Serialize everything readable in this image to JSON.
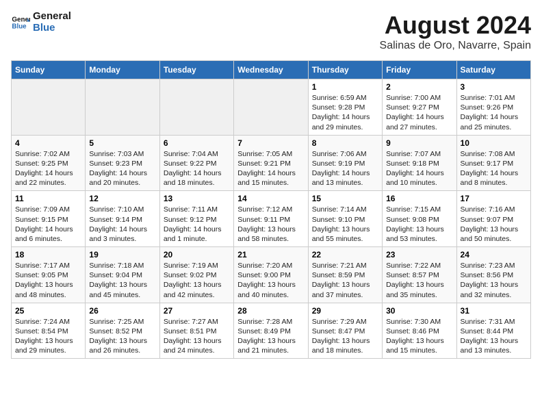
{
  "header": {
    "logo_line1": "General",
    "logo_line2": "Blue",
    "title": "August 2024",
    "subtitle": "Salinas de Oro, Navarre, Spain"
  },
  "weekdays": [
    "Sunday",
    "Monday",
    "Tuesday",
    "Wednesday",
    "Thursday",
    "Friday",
    "Saturday"
  ],
  "weeks": [
    [
      {
        "day": "",
        "info": ""
      },
      {
        "day": "",
        "info": ""
      },
      {
        "day": "",
        "info": ""
      },
      {
        "day": "",
        "info": ""
      },
      {
        "day": "1",
        "info": "Sunrise: 6:59 AM\nSunset: 9:28 PM\nDaylight: 14 hours\nand 29 minutes."
      },
      {
        "day": "2",
        "info": "Sunrise: 7:00 AM\nSunset: 9:27 PM\nDaylight: 14 hours\nand 27 minutes."
      },
      {
        "day": "3",
        "info": "Sunrise: 7:01 AM\nSunset: 9:26 PM\nDaylight: 14 hours\nand 25 minutes."
      }
    ],
    [
      {
        "day": "4",
        "info": "Sunrise: 7:02 AM\nSunset: 9:25 PM\nDaylight: 14 hours\nand 22 minutes."
      },
      {
        "day": "5",
        "info": "Sunrise: 7:03 AM\nSunset: 9:23 PM\nDaylight: 14 hours\nand 20 minutes."
      },
      {
        "day": "6",
        "info": "Sunrise: 7:04 AM\nSunset: 9:22 PM\nDaylight: 14 hours\nand 18 minutes."
      },
      {
        "day": "7",
        "info": "Sunrise: 7:05 AM\nSunset: 9:21 PM\nDaylight: 14 hours\nand 15 minutes."
      },
      {
        "day": "8",
        "info": "Sunrise: 7:06 AM\nSunset: 9:19 PM\nDaylight: 14 hours\nand 13 minutes."
      },
      {
        "day": "9",
        "info": "Sunrise: 7:07 AM\nSunset: 9:18 PM\nDaylight: 14 hours\nand 10 minutes."
      },
      {
        "day": "10",
        "info": "Sunrise: 7:08 AM\nSunset: 9:17 PM\nDaylight: 14 hours\nand 8 minutes."
      }
    ],
    [
      {
        "day": "11",
        "info": "Sunrise: 7:09 AM\nSunset: 9:15 PM\nDaylight: 14 hours\nand 6 minutes."
      },
      {
        "day": "12",
        "info": "Sunrise: 7:10 AM\nSunset: 9:14 PM\nDaylight: 14 hours\nand 3 minutes."
      },
      {
        "day": "13",
        "info": "Sunrise: 7:11 AM\nSunset: 9:12 PM\nDaylight: 14 hours\nand 1 minute."
      },
      {
        "day": "14",
        "info": "Sunrise: 7:12 AM\nSunset: 9:11 PM\nDaylight: 13 hours\nand 58 minutes."
      },
      {
        "day": "15",
        "info": "Sunrise: 7:14 AM\nSunset: 9:10 PM\nDaylight: 13 hours\nand 55 minutes."
      },
      {
        "day": "16",
        "info": "Sunrise: 7:15 AM\nSunset: 9:08 PM\nDaylight: 13 hours\nand 53 minutes."
      },
      {
        "day": "17",
        "info": "Sunrise: 7:16 AM\nSunset: 9:07 PM\nDaylight: 13 hours\nand 50 minutes."
      }
    ],
    [
      {
        "day": "18",
        "info": "Sunrise: 7:17 AM\nSunset: 9:05 PM\nDaylight: 13 hours\nand 48 minutes."
      },
      {
        "day": "19",
        "info": "Sunrise: 7:18 AM\nSunset: 9:04 PM\nDaylight: 13 hours\nand 45 minutes."
      },
      {
        "day": "20",
        "info": "Sunrise: 7:19 AM\nSunset: 9:02 PM\nDaylight: 13 hours\nand 42 minutes."
      },
      {
        "day": "21",
        "info": "Sunrise: 7:20 AM\nSunset: 9:00 PM\nDaylight: 13 hours\nand 40 minutes."
      },
      {
        "day": "22",
        "info": "Sunrise: 7:21 AM\nSunset: 8:59 PM\nDaylight: 13 hours\nand 37 minutes."
      },
      {
        "day": "23",
        "info": "Sunrise: 7:22 AM\nSunset: 8:57 PM\nDaylight: 13 hours\nand 35 minutes."
      },
      {
        "day": "24",
        "info": "Sunrise: 7:23 AM\nSunset: 8:56 PM\nDaylight: 13 hours\nand 32 minutes."
      }
    ],
    [
      {
        "day": "25",
        "info": "Sunrise: 7:24 AM\nSunset: 8:54 PM\nDaylight: 13 hours\nand 29 minutes."
      },
      {
        "day": "26",
        "info": "Sunrise: 7:25 AM\nSunset: 8:52 PM\nDaylight: 13 hours\nand 26 minutes."
      },
      {
        "day": "27",
        "info": "Sunrise: 7:27 AM\nSunset: 8:51 PM\nDaylight: 13 hours\nand 24 minutes."
      },
      {
        "day": "28",
        "info": "Sunrise: 7:28 AM\nSunset: 8:49 PM\nDaylight: 13 hours\nand 21 minutes."
      },
      {
        "day": "29",
        "info": "Sunrise: 7:29 AM\nSunset: 8:47 PM\nDaylight: 13 hours\nand 18 minutes."
      },
      {
        "day": "30",
        "info": "Sunrise: 7:30 AM\nSunset: 8:46 PM\nDaylight: 13 hours\nand 15 minutes."
      },
      {
        "day": "31",
        "info": "Sunrise: 7:31 AM\nSunset: 8:44 PM\nDaylight: 13 hours\nand 13 minutes."
      }
    ]
  ]
}
